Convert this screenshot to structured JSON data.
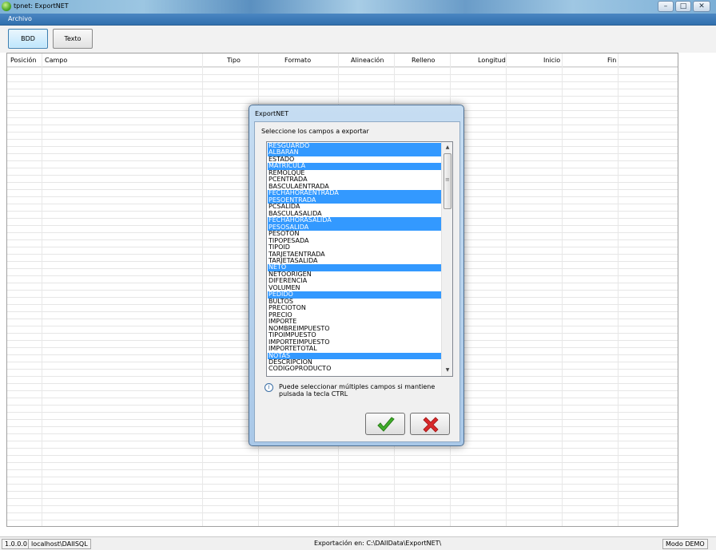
{
  "window": {
    "title": "tpnet: ExportNET",
    "icon": "app-icon",
    "controls": [
      "minimize-icon",
      "maximize-icon",
      "close-icon"
    ]
  },
  "menu": {
    "items": [
      {
        "label": "Archivo"
      }
    ]
  },
  "toolbar": {
    "buttons": [
      {
        "label": "BDD",
        "active": true
      },
      {
        "label": "Texto",
        "active": false
      }
    ]
  },
  "grid": {
    "columns": [
      "Posición",
      "Campo",
      "Tipo",
      "Formato",
      "Alineación",
      "Relleno",
      "Longitud",
      "Inicio",
      "Fin"
    ]
  },
  "dialog": {
    "title": "ExportNET",
    "prompt": "Seleccione los campos a exportar",
    "fields": [
      {
        "label": "RESGUARDO",
        "selected": true
      },
      {
        "label": "ALBARAN",
        "selected": true
      },
      {
        "label": "ESTADO",
        "selected": false
      },
      {
        "label": "MATRICULA",
        "selected": true
      },
      {
        "label": "REMOLQUE",
        "selected": false
      },
      {
        "label": "PCENTRADA",
        "selected": false
      },
      {
        "label": "BASCULAENTRADA",
        "selected": false
      },
      {
        "label": "FECHAHORAENTRADA",
        "selected": true
      },
      {
        "label": "PESOENTRADA",
        "selected": true
      },
      {
        "label": "PCSALIDA",
        "selected": false
      },
      {
        "label": "BASCULASALIDA",
        "selected": false
      },
      {
        "label": "FECHAHORASALIDA",
        "selected": true
      },
      {
        "label": "PESOSALIDA",
        "selected": true
      },
      {
        "label": "PESOTON",
        "selected": false
      },
      {
        "label": "TIPOPESADA",
        "selected": false
      },
      {
        "label": "TIPOID",
        "selected": false
      },
      {
        "label": "TARJETAENTRADA",
        "selected": false
      },
      {
        "label": "TARJETASALIDA",
        "selected": false
      },
      {
        "label": "NETO",
        "selected": true
      },
      {
        "label": "NETOORIGEN",
        "selected": false
      },
      {
        "label": "DIFERENCIA",
        "selected": false
      },
      {
        "label": "VOLUMEN",
        "selected": false
      },
      {
        "label": "PEDIDO",
        "selected": true
      },
      {
        "label": "BULTOS",
        "selected": false
      },
      {
        "label": "PRECIOTON",
        "selected": false
      },
      {
        "label": "PRECIO",
        "selected": false
      },
      {
        "label": "IMPORTE",
        "selected": false
      },
      {
        "label": "NOMBREIMPUESTO",
        "selected": false
      },
      {
        "label": "TIPOIMPUESTO",
        "selected": false
      },
      {
        "label": "IMPORTEIMPUESTO",
        "selected": false
      },
      {
        "label": "IMPORTETOTAL",
        "selected": false
      },
      {
        "label": "NOTAS",
        "selected": true
      },
      {
        "label": "DESCRIPCION",
        "selected": false
      },
      {
        "label": "CODIGOPRODUCTO",
        "selected": false
      }
    ],
    "info": "Puede seleccionar múltiples campos si mantiene pulsada la tecla CTRL",
    "ok_icon": "check-icon",
    "cancel_icon": "x-icon",
    "selected_color": "#3399ff"
  },
  "status": {
    "version": "1.0.0.0",
    "server": "localhost\\DAIISQL",
    "export_path": "Exportación en: C:\\DAIIData\\ExportNET\\",
    "mode": "Modo DEMO"
  }
}
